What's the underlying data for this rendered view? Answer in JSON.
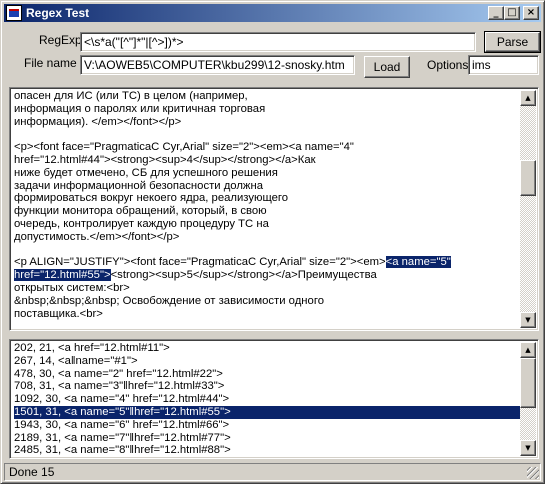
{
  "window": {
    "title": "Regex Test"
  },
  "titlebar": {
    "minimize_glyph": "_",
    "maximize_glyph": "□",
    "close_glyph": "×"
  },
  "form": {
    "regexp_label": "RegExp",
    "regexp_value": "<\\s*a(\"[^\"]*\"|[^>])*>",
    "filename_label": "File name",
    "filename_value": "V:\\AOWEB5\\COMPUTER\\kbu299\\12-snosky.htm",
    "options_label": "Options",
    "options_value": "ims",
    "parse_button": "Parse",
    "load_button": "Load"
  },
  "source": {
    "lines": [
      {
        "text": "опасен для ИС (или ТС) в целом (например,"
      },
      {
        "text": "информация о паролях или критичная торговая"
      },
      {
        "text": "информация). </em></font></p>"
      },
      {
        "text": ""
      },
      {
        "text": "<p><font face=\"PragmaticaC Cyr,Arial\" size=\"2\"><em><a name=\"4\""
      },
      {
        "text": "href=\"12.html#44\"><strong><sup>4</sup></strong></a>Как"
      },
      {
        "text": "ниже будет отмечено, СБ для успешного решения"
      },
      {
        "text": "задачи информационной безопасности должна"
      },
      {
        "text": "формироваться вокруг некоего ядра, реализующего"
      },
      {
        "text": "функции монитора обращений, который, в свою"
      },
      {
        "text": "очередь, контролирует каждую процедуру ТС на"
      },
      {
        "text": "допустимость.</em></font></p>"
      },
      {
        "text": ""
      },
      {
        "pre": "<p ALIGN=\"JUSTIFY\"><font face=\"PragmaticaC Cyr,Arial\" size=\"2\"><em>",
        "hl": "<a name=\"5\"",
        "post": ""
      },
      {
        "pre": "",
        "hl": "href=\"12.html#55\">",
        "post": "<strong><sup>5</sup></strong></a>Преимущества"
      },
      {
        "text": "открытых систем:<br>"
      },
      {
        "text": "&nbsp;&nbsp;&nbsp; Освобождение от зависимости одного"
      },
      {
        "text": "поставщика.<br>"
      }
    ]
  },
  "matches": {
    "selected_index": 5,
    "items": [
      "202, 21, <a href=\"12.html#11\">",
      "267, 14, <a‖name=\"#1\">",
      "478, 30, <a name=\"2\" href=\"12.html#22\">",
      "708, 31, <a name=\"3\"‖href=\"12.html#33\">",
      "1092, 30, <a name=\"4\" href=\"12.html#44\">",
      "1501, 31, <a name=\"5\"‖href=\"12.html#55\">",
      "1943, 30, <a name=\"6\" href=\"12.html#66\">",
      "2189, 31, <a name=\"7\"‖href=\"12.html#77\">",
      "2485, 31, <a name=\"8\"‖href=\"12.html#88\">"
    ]
  },
  "status": {
    "text": "Done 15"
  },
  "colors": {
    "selection": "#0a246a",
    "titlebar_start": "#0a246a",
    "titlebar_end": "#a6caf0",
    "face": "#d4d0c8"
  },
  "scrollbars": {
    "source": {
      "up_glyph": "▲",
      "down_glyph": "▼"
    },
    "matches": {
      "up_glyph": "▲",
      "down_glyph": "▼"
    }
  }
}
